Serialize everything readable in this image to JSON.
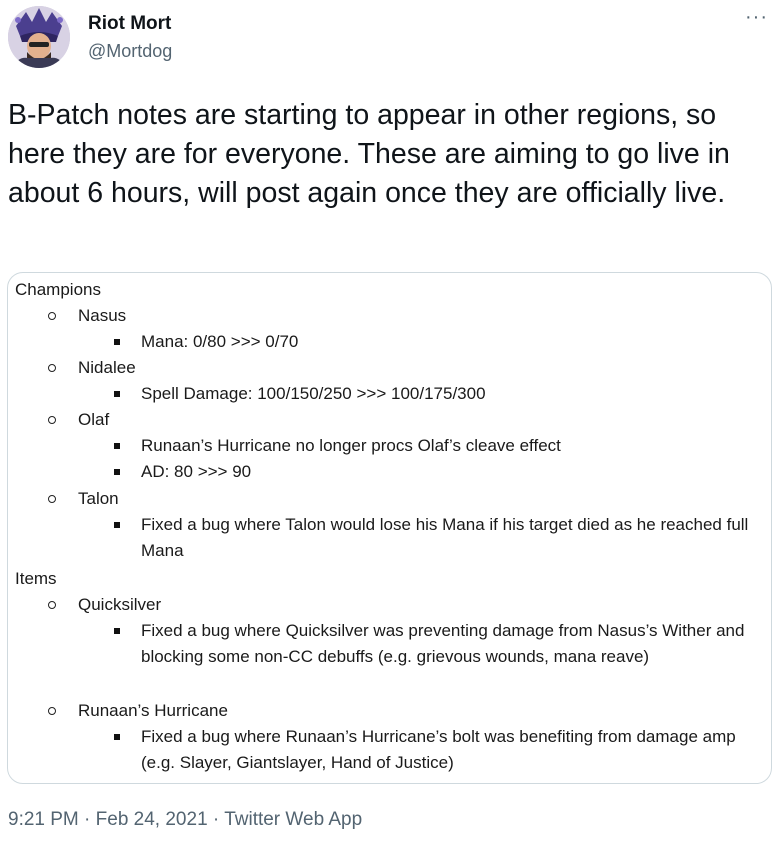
{
  "author": {
    "display_name": "Riot Mort",
    "handle": "@Mortdog"
  },
  "menu": {
    "more_label": "···"
  },
  "tweet": {
    "text": "B-Patch notes are starting to appear in other regions, so here they are for everyone. These are aiming to go live in about 6 hours, will post again once they are officially live."
  },
  "notes": {
    "champions_heading": "Champions",
    "nasus": "Nasus",
    "nasus_1": "Mana: 0/80 >>> 0/70",
    "nidalee": "Nidalee",
    "nidalee_1": "Spell Damage: 100/150/250 >>> 100/175/300",
    "olaf": "Olaf",
    "olaf_1": "Runaan’s Hurricane no longer procs Olaf’s cleave effect",
    "olaf_2": "AD: 80 >>> 90",
    "talon": "Talon",
    "talon_1": "Fixed a bug where Talon would lose his Mana if his target died as he reached full Mana",
    "items_heading": "Items",
    "quicksilver": "Quicksilver",
    "quicksilver_1": "Fixed a bug where Quicksilver was preventing damage from Nasus’s Wither and blocking some non-CC debuffs (e.g. grievous wounds, mana reave)",
    "runaans": "Runaan’s Hurricane",
    "runaans_1": "Fixed a bug where Runaan’s Hurricane’s bolt was benefiting from damage amp (e.g. Slayer, Giantslayer, Hand of Justice)"
  },
  "meta": {
    "time": "9:21 PM",
    "sep1": " · ",
    "date": "Feb 24, 2021",
    "sep2": " · ",
    "app": "Twitter Web App"
  },
  "colors": {
    "text": "#0f1419",
    "secondary": "#536471",
    "border": "#cfd9de"
  }
}
